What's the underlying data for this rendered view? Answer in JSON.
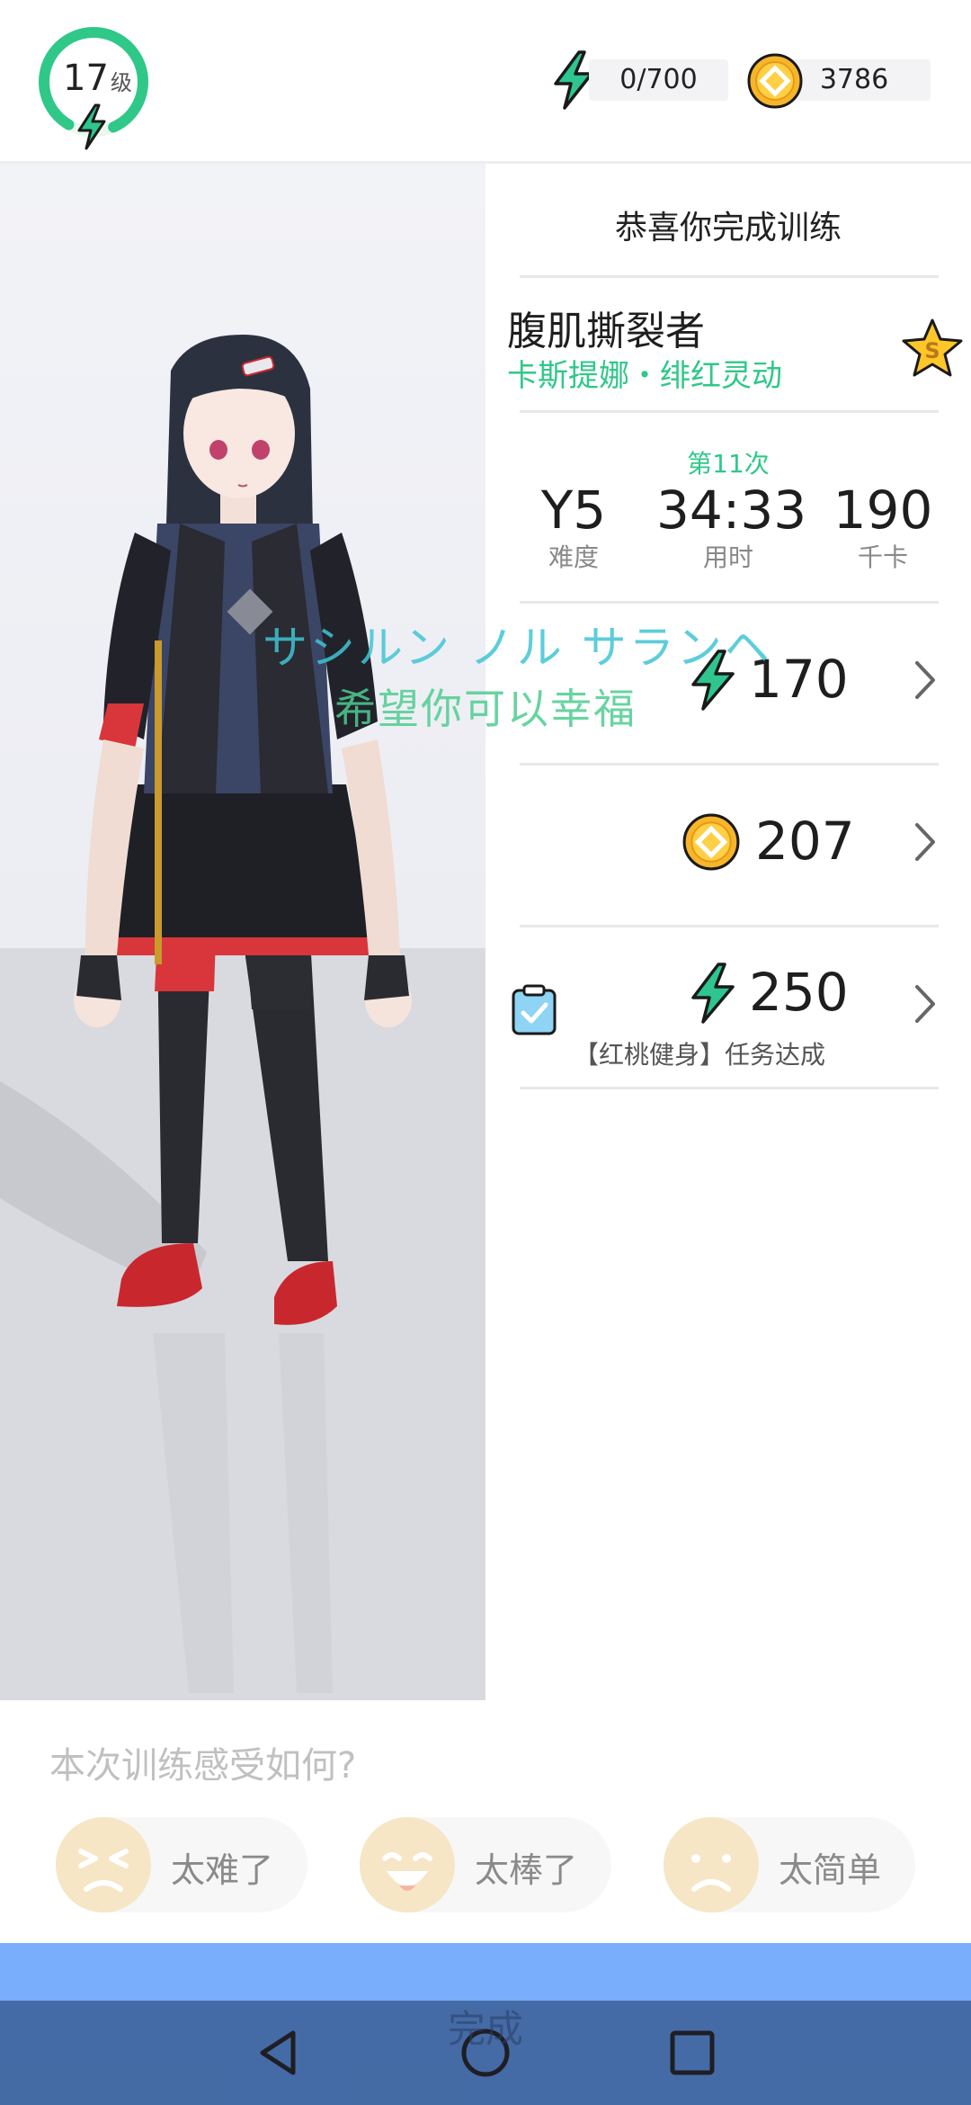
{
  "top": {
    "level_number": "17",
    "level_unit": "级",
    "level_progress": 0.85,
    "energy_value": "0/700",
    "coins_value": "3786"
  },
  "results": {
    "congrats": "恭喜你完成训练",
    "course_title": "腹肌撕裂者",
    "course_subtitle": "卡斯提娜・绯红灵动",
    "rank_badge": "S",
    "session_count": "第11次",
    "stats": [
      {
        "value": "Y5",
        "label": "难度"
      },
      {
        "value": "34:33",
        "label": "用时"
      },
      {
        "value": "190",
        "label": "千卡"
      }
    ],
    "rewards": [
      {
        "type": "energy",
        "amount": "170"
      },
      {
        "type": "coin",
        "amount": "207"
      },
      {
        "type": "energy",
        "amount": "250",
        "note": "【红桃健身】任务达成"
      }
    ]
  },
  "overlay": {
    "line1": "サシルン ノル サランヘ",
    "line2": "希望你可以幸福"
  },
  "feedback": {
    "question": "本次训练感受如何?",
    "options": [
      "太难了",
      "太棒了",
      "太简单"
    ]
  },
  "done_label": "完成",
  "colors": {
    "accent_green": "#2fc889",
    "energy_green": "#2ec58e",
    "coin_gold": "#f7b52c",
    "done_blue": "#78aefc",
    "nav_bar": "#3c5f96"
  },
  "icons": [
    "energy-bolt-icon",
    "coin-icon",
    "rank-badge-icon",
    "chevron-right-icon",
    "task-clipboard-icon",
    "back-nav-icon",
    "home-nav-icon",
    "recents-nav-icon"
  ]
}
